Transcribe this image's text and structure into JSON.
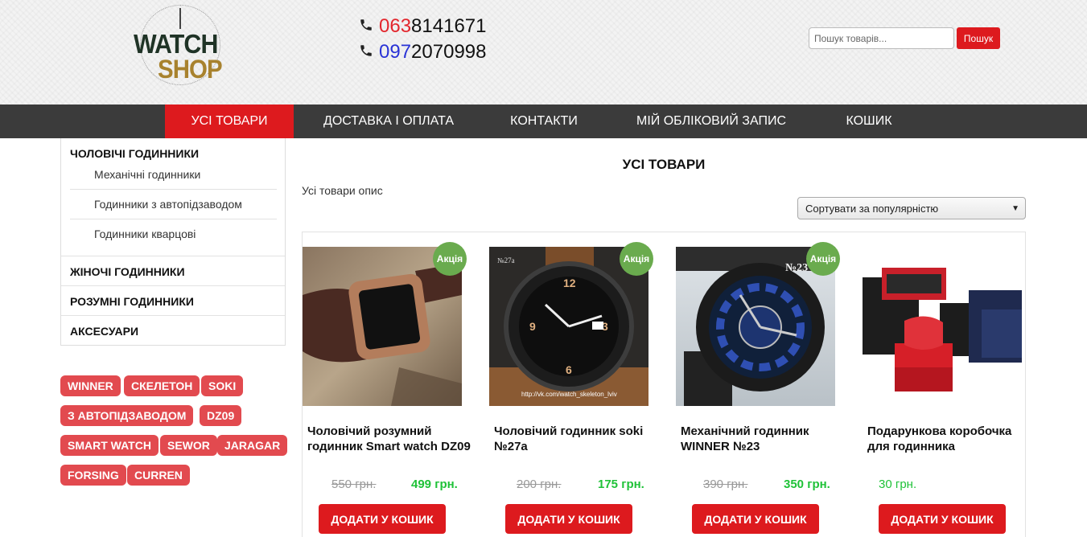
{
  "header": {
    "logo_top": "WATCH",
    "logo_bottom": "SHOP",
    "phones": [
      {
        "prefix": "063",
        "rest": "8141671"
      },
      {
        "prefix": "097",
        "rest": "2070998"
      }
    ],
    "search_placeholder": "Пошук товарів...",
    "search_button": "Пошук"
  },
  "nav": {
    "items": [
      "УСІ ТОВАРИ",
      "ДОСТАВКА І ОПЛАТА",
      "КОНТАКТИ",
      "МІЙ ОБЛІКОВИЙ ЗАПИС",
      "КОШИК"
    ]
  },
  "sidebar": {
    "cat_men": "ЧОЛОВІЧІ ГОДИННИКИ",
    "sub": [
      "Механічні годинники",
      "Годинники з автопідзаводом",
      "Годинники кварцові"
    ],
    "cat_women": "ЖІНОЧІ ГОДИННИКИ",
    "cat_smart": "РОЗУМНІ ГОДИННИКИ",
    "cat_acc": "АКСЕСУАРИ"
  },
  "tags": [
    "WINNER",
    "СКЕЛЕТОН",
    "SOKI",
    "З АВТОПІДЗАВОДОМ",
    "DZ09",
    "SMART WATCH",
    "SEWOR",
    "JARAGAR",
    "FORSING",
    "CURREN"
  ],
  "main": {
    "title": "УСІ ТОВАРИ",
    "description": "Усі товари опис",
    "sort_selected": "Сортувати за популярністю"
  },
  "products": [
    {
      "name": "Чоловічий розумний годинник Smart watch DZ09",
      "old_price": "550 грн.",
      "price": "499 грн.",
      "badge": "Акція",
      "button": "ДОДАТИ У КОШИК"
    },
    {
      "name": "Чоловічий годинник soki №27a",
      "old_price": "200 грн.",
      "price": "175 грн.",
      "badge": "Акція",
      "button": "ДОДАТИ У КОШИК"
    },
    {
      "name": "Механічний годинник WINNER №23",
      "old_price": "390 грн.",
      "price": "350 грн.",
      "badge": "Акція",
      "button": "ДОДАТИ У КОШИК"
    },
    {
      "name": "Подарункова коробочка для годинника",
      "price": "30 грн.",
      "button": "ДОДАТИ У КОШИК"
    }
  ],
  "image_texts": {
    "watch2_label": "№27a",
    "watch2_url": "http://vk.com/watch_skeleton_lviv",
    "watch3_label": "№23"
  },
  "colors": {
    "accent_red": "#dd1a1e",
    "nav_bg": "#3b3b3b",
    "sale_green": "#6aab4e",
    "price_green": "#1fc238",
    "tag_red": "#e24a4f"
  }
}
